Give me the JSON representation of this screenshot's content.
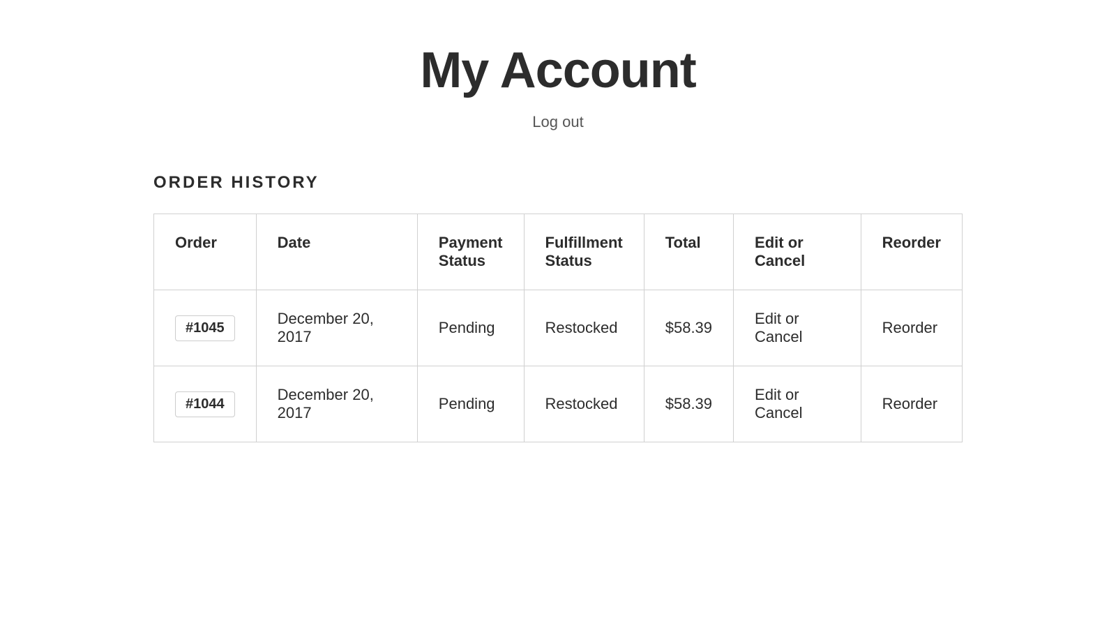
{
  "header": {
    "title": "My Account",
    "logout_label": "Log out"
  },
  "order_history": {
    "section_title": "ORDER HISTORY",
    "columns": [
      {
        "key": "order",
        "label": "Order"
      },
      {
        "key": "date",
        "label": "Date"
      },
      {
        "key": "payment_status",
        "label": "Payment Status"
      },
      {
        "key": "fulfillment_status",
        "label": "Fulfillment Status"
      },
      {
        "key": "total",
        "label": "Total"
      },
      {
        "key": "edit_cancel",
        "label": "Edit or Cancel"
      },
      {
        "key": "reorder",
        "label": "Reorder"
      }
    ],
    "rows": [
      {
        "order_number": "#1045",
        "date": "December 20, 2017",
        "payment_status": "Pending",
        "fulfillment_status": "Restocked",
        "total": "$58.39",
        "edit_cancel": "Edit or Cancel",
        "reorder": "Reorder"
      },
      {
        "order_number": "#1044",
        "date": "December 20, 2017",
        "payment_status": "Pending",
        "fulfillment_status": "Restocked",
        "total": "$58.39",
        "edit_cancel": "Edit or Cancel",
        "reorder": "Reorder"
      }
    ]
  }
}
